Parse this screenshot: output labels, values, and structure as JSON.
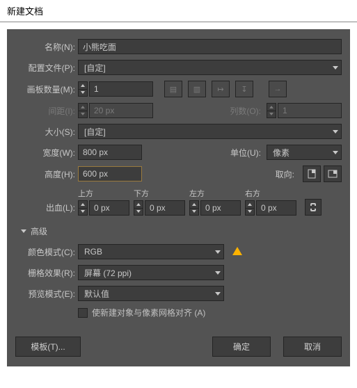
{
  "title": "新建文档",
  "name": {
    "label": "名称(N):",
    "value": "小熊吃面"
  },
  "profile": {
    "label": "配置文件(P):",
    "value": "[自定]"
  },
  "artboards": {
    "count_label": "画板数量(M):",
    "count_value": "1",
    "spacing_label": "间距(I):",
    "spacing_value": "20 px",
    "cols_label": "列数(O):",
    "cols_value": "1"
  },
  "size": {
    "label": "大小(S):",
    "value": "[自定]"
  },
  "width": {
    "label": "宽度(W):",
    "value": "800 px"
  },
  "unit": {
    "label": "单位(U):",
    "value": "像素"
  },
  "height": {
    "label": "高度(H):",
    "value": "600 px"
  },
  "orientation_label": "取向:",
  "bleed": {
    "label": "出血(L):",
    "top_label": "上方",
    "bottom_label": "下方",
    "left_label": "左方",
    "right_label": "右方",
    "value": "0 px"
  },
  "advanced_label": "高级",
  "color_mode": {
    "label": "颜色模式(C):",
    "value": "RGB"
  },
  "raster": {
    "label": "栅格效果(R):",
    "value": "屏幕 (72 ppi)"
  },
  "preview": {
    "label": "预览模式(E):",
    "value": "默认值"
  },
  "align_pixel_label": "使新建对象与像素网格对齐 (A)",
  "template_btn": "模板(T)...",
  "ok_btn": "确定",
  "cancel_btn": "取消"
}
